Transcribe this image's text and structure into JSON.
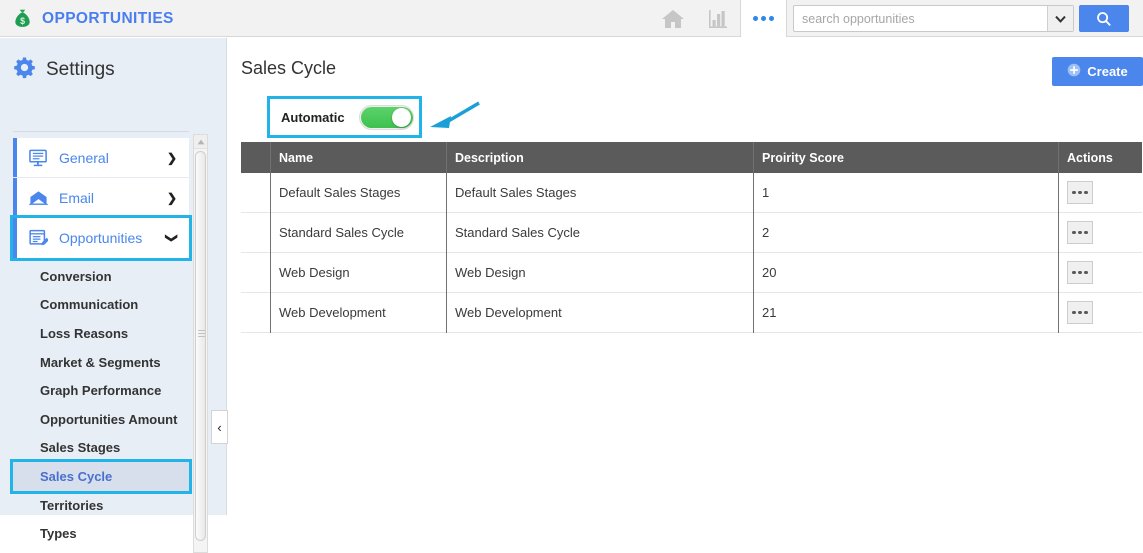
{
  "topbar": {
    "brand": "OPPORTUNITIES",
    "brand_icon": "money-bag-icon",
    "brand_color": "#4a7ef0",
    "home_icon": "home-icon",
    "reports_icon": "bar-chart-icon",
    "more_icon": "three-dots-icon",
    "search": {
      "placeholder": "search opportunities",
      "value": "",
      "dropdown_icon": "chevron-down-icon",
      "button_icon": "search-icon",
      "button_color": "#4a86ec"
    }
  },
  "sidebar": {
    "title": "Settings",
    "title_icon": "gear-icon",
    "main_items": [
      {
        "label": "General",
        "icon": "monitor-icon",
        "chevron": "❯",
        "active": false
      },
      {
        "label": "Email",
        "icon": "envelope-icon",
        "chevron": "❯",
        "active": false
      },
      {
        "label": "Opportunities",
        "icon": "document-edit-icon",
        "chevron": "❯",
        "active": true
      }
    ],
    "sub_items": [
      {
        "label": "Conversion",
        "selected": false
      },
      {
        "label": "Communication",
        "selected": false
      },
      {
        "label": "Loss Reasons",
        "selected": false
      },
      {
        "label": "Market & Segments",
        "selected": false
      },
      {
        "label": "Graph Performance",
        "selected": false
      },
      {
        "label": "Opportunities Amount",
        "selected": false
      },
      {
        "label": "Sales Stages",
        "selected": false
      },
      {
        "label": "Sales Cycle",
        "selected": true
      },
      {
        "label": "Territories",
        "selected": false
      },
      {
        "label": "Types",
        "selected": false
      }
    ],
    "collapse_icon": "chevron-left-icon",
    "highlight_color": "#22b3e8"
  },
  "main": {
    "page_title": "Sales Cycle",
    "create_button": {
      "label": "Create",
      "icon": "plus-circle-icon"
    },
    "automatic_toggle": {
      "label": "Automatic",
      "state": "on",
      "on_color": "#3dc14f"
    },
    "annotation_arrow": "arrow-left-icon",
    "table": {
      "columns": [
        "",
        "Name",
        "Description",
        "Proirity Score",
        "Actions"
      ],
      "rows": [
        {
          "name": "Default Sales Stages",
          "description": "Default Sales Stages",
          "priority": "1",
          "action_icon": "three-dots-icon"
        },
        {
          "name": "Standard Sales Cycle",
          "description": "Standard Sales Cycle",
          "priority": "2",
          "action_icon": "three-dots-icon"
        },
        {
          "name": "Web Design",
          "description": "Web Design",
          "priority": "20",
          "action_icon": "three-dots-icon"
        },
        {
          "name": "Web Development",
          "description": "Web Development",
          "priority": "21",
          "action_icon": "three-dots-icon"
        }
      ]
    }
  }
}
